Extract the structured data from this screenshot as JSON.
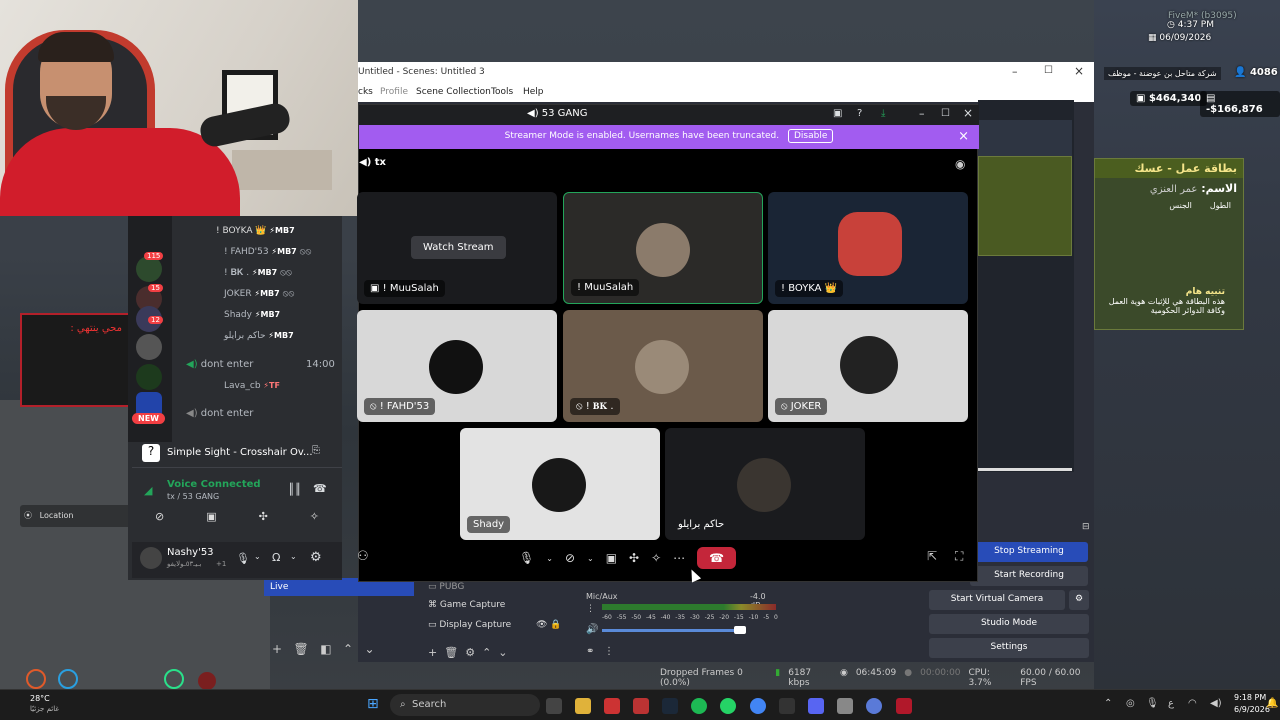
{
  "hud": {
    "server": "FiveM* (b3095)",
    "time": "4:37 PM",
    "date": "06/09/2026",
    "company": "شركة متاحل بن عوضنة - موظف",
    "id": "4086",
    "cash": "$464,340",
    "bank": "-$166,876",
    "location": "Location",
    "weather_temp": "28°C",
    "weather_desc": "غائم جزئيًا"
  },
  "job_card": {
    "title": "بطاقة عمل - عسك",
    "name_label": "الاسم:",
    "name_value": "عمر العنزي",
    "height_label": "الطول",
    "gender_label": "الجنس",
    "warning_title": "تنبيه هام",
    "warning_text": "هذه البطاقة هي للإثبات هوية العمل وكافة الدوائر الحكومية"
  },
  "game_sign": "محي ينتهي :",
  "obs": {
    "title": "Untitled - Scenes: Untitled 3",
    "menu": [
      "cks",
      "Profile",
      "Scene Collection",
      "Tools",
      "Help"
    ],
    "sources": [
      {
        "name": "PUBG"
      },
      {
        "name": "Game Capture"
      },
      {
        "name": "Display Capture"
      }
    ],
    "scene_live": "Live",
    "mixer_name": "Mic/Aux",
    "mixer_db": "-4.0 dB",
    "mixer_ticks": [
      "-60",
      "-55",
      "-50",
      "-45",
      "-40",
      "-35",
      "-30",
      "-25",
      "-20",
      "-15",
      "-10",
      "-5",
      "0"
    ],
    "buttons": {
      "stop_streaming": "Stop Streaming",
      "start_recording": "Start Recording",
      "start_virtual_camera": "Start Virtual Camera",
      "studio_mode": "Studio Mode",
      "settings": "Settings"
    },
    "status": {
      "dropped": "Dropped Frames 0 (0.0%)",
      "kbps": "6187 kbps",
      "stream_time": "06:45:09",
      "rec_time": "00:00:00",
      "cpu": "CPU: 3.7%",
      "fps": "60.00 / 60.00 FPS"
    }
  },
  "discord": {
    "window_title": "53 GANG",
    "banner_text": "Streamer Mode is enabled. Usernames have been truncated.",
    "banner_button": "Disable",
    "channel": "tx",
    "watch_stream": "Watch Stream",
    "tiles": [
      {
        "label": "! MuuSalah",
        "screen": true
      },
      {
        "label": "! MuuSalah"
      },
      {
        "label": "! BOYKA 👑"
      },
      {
        "label": "! FAHD'53"
      },
      {
        "label": "! 𝐁𝐊 ."
      },
      {
        "label": "JOKER"
      },
      {
        "label": "Shady"
      },
      {
        "label": "حاكم برايلو"
      }
    ],
    "members": [
      {
        "name": "! BOYKA 👑",
        "tag": "⚡MB7"
      },
      {
        "name": "! FAHD'53",
        "tag": "⚡MB7"
      },
      {
        "name": "! 𝐁𝐊 .",
        "tag": "⚡MB7"
      },
      {
        "name": "JOKER",
        "tag": "⚡MB7"
      },
      {
        "name": "Shady",
        "tag": "⚡MB7"
      },
      {
        "name": "حاكم برايلو",
        "tag": "⚡MB7"
      }
    ],
    "channel_dont_enter_1": "dont enter",
    "channel_time": "14:00",
    "lava_member": "Lava_cb",
    "lava_tag": "⚡TF",
    "channel_dont_enter_2": "dont enter",
    "badges": [
      "115",
      "15",
      "12"
    ],
    "new_badge": "NEW",
    "activity_title": "Simple Sight - Crosshair Ov...",
    "voice_connected": "Voice Connected",
    "voice_channel": "tx / 53 GANG",
    "user_name": "Nashy'53",
    "user_status": "بـيـ٥٣ـولايفو",
    "user_extra": "+1"
  },
  "taskbar": {
    "search": "Search",
    "time": "9:18 PM",
    "date": "6/9/2026",
    "lang": "ع"
  },
  "colors": {
    "discord_purple": "#a25cf0",
    "hangup_red": "#c4263a",
    "obs_blue": "#284cb8",
    "voice_green": "#23a55a"
  }
}
